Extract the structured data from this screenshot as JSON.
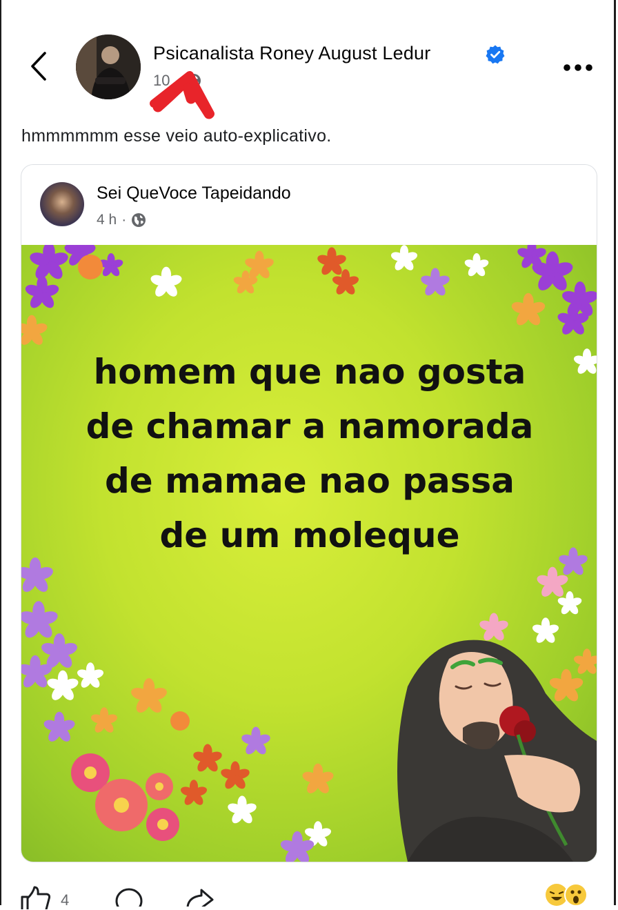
{
  "header": {
    "author_name": "Psicanalista Roney August Ledur",
    "timestamp": "10",
    "visibility_icon": "globe-icon",
    "back_icon": "chevron-left-icon",
    "more_icon": "more-horizontal-icon"
  },
  "post": {
    "caption": "hmmmmmm esse veio auto-explicativo."
  },
  "shared_post": {
    "author_name": "Sei QueVoce Tapeidando",
    "timestamp": "4 h",
    "visibility_icon": "globe-icon",
    "meme_lines": [
      "homem que nao gosta",
      "de chamar a namorada",
      "de mamae nao passa",
      "de um moleque"
    ]
  },
  "actions": {
    "like_count": "4",
    "like_icon": "thumbs-up-icon",
    "comment_icon": "comment-icon",
    "share_icon": "share-icon"
  },
  "colors": {
    "verified": "#1877f2",
    "meta_text": "#65676b",
    "annotation_arrow": "#e8242a"
  }
}
